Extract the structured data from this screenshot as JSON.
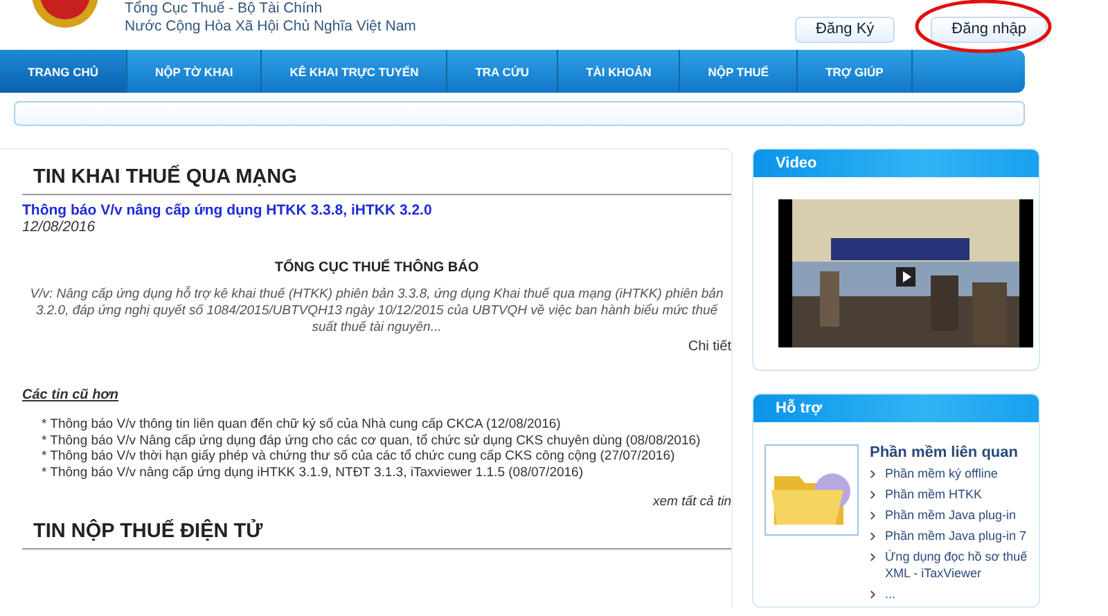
{
  "header": {
    "agency": "Tổng Cục Thuế - Bộ Tài Chính",
    "country": "Nước Cộng Hòa Xã Hội Chủ Nghĩa Việt Nam",
    "buttons": [
      {
        "label": "Đăng Ký",
        "circled": false
      },
      {
        "label": "Đăng nhập",
        "circled": true
      }
    ]
  },
  "nav": [
    {
      "label": "TRANG CHỦ",
      "selected": true
    },
    {
      "label": "NỘP TỜ KHAI",
      "selected": false
    },
    {
      "label": "KÊ KHAI TRỰC TUYẾN",
      "selected": false
    },
    {
      "label": "TRA CỨU",
      "selected": false
    },
    {
      "label": "TÀI KHOẢN",
      "selected": false
    },
    {
      "label": "NỘP THUẾ",
      "selected": false
    },
    {
      "label": "TRỢ GIÚP",
      "selected": false
    }
  ],
  "news": {
    "title": "TIN KHAI THUẾ QUA MẠNG",
    "headline": "Thông báo V/v nâng cấp ứng dụng HTKK 3.3.8, iHTKK 3.2.0",
    "date": "12/08/2016",
    "notice_title": "TỔNG CỤC THUẾ THÔNG BÁO",
    "summary": "V/v: Nâng cấp ứng dụng hỗ trợ kê khai thuế (HTKK) phiên bản 3.3.8, ứng dụng Khai thuế qua mạng (iHTKK) phiên bản 3.2.0, đáp ứng nghị quyết số 1084/2015/UBTVQH13 ngày 10/12/2015 của UBTVQH về việc ban hành biểu mức thuế suất thuế tài nguyên...",
    "detail_link": "Chi tiết",
    "older_title": "Các tin cũ hơn",
    "older": [
      "* Thông báo V/v thông tin liên quan đến chữ ký số của Nhà cung cấp CKCA (12/08/2016)",
      "* Thông báo V/v Nâng cấp ứng dụng đáp ứng cho các cơ quan, tổ chức sử dụng CKS chuyên dùng (08/08/2016)",
      "* Thông báo V/v thời hạn giấy phép và chứng thư số của các tổ chức cung cấp CKS công cộng (27/07/2016)",
      "* Thông báo V/v nâng cấp ứng dụng iHTKK 3.1.9, NTĐT 3.1.3, iTaxviewer 1.1.5 (08/07/2016)"
    ],
    "see_all": "xem tất cả tin",
    "next_title": "TIN NỘP THUẾ ĐIỆN TỬ"
  },
  "video": {
    "title": "Video"
  },
  "support": {
    "title": "Hỗ trợ",
    "heading": "Phần mềm liên quan",
    "links": [
      "Phần mềm ký offline",
      "Phần mềm HTKK",
      "Phần mềm Java plug-in",
      "Phần mềm Java plug-in 7",
      "Ứng dụng đọc hồ sơ thuế XML - iTaxViewer",
      "..."
    ]
  }
}
